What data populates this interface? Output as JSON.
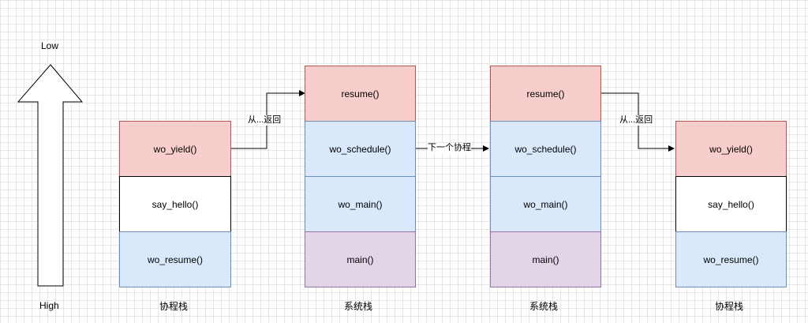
{
  "arrow": {
    "top_label": "Low",
    "bottom_label": "High"
  },
  "stacks": [
    {
      "caption": "协程栈",
      "frames": [
        "wo_yield()",
        "say_hello()",
        "wo_resume()"
      ]
    },
    {
      "caption": "系统栈",
      "frames": [
        "resume()",
        "wo_schedule()",
        "wo_main()",
        "main()"
      ]
    },
    {
      "caption": "系统栈",
      "frames": [
        "resume()",
        "wo_schedule()",
        "wo_main()",
        "main()"
      ]
    },
    {
      "caption": "协程栈",
      "frames": [
        "wo_yield()",
        "say_hello()",
        "wo_resume()"
      ]
    }
  ],
  "edges": {
    "from_return_1": "从...返回",
    "next_coroutine": "下一个协程",
    "from_return_2": "从...返回"
  },
  "colors": {
    "red_fill": "#f8cecc",
    "red_stroke": "#b85450",
    "blue_fill": "#dae8fc",
    "blue_stroke": "#6c8ebf",
    "purple_fill": "#e1d5e7",
    "purple_stroke": "#9673a6"
  }
}
